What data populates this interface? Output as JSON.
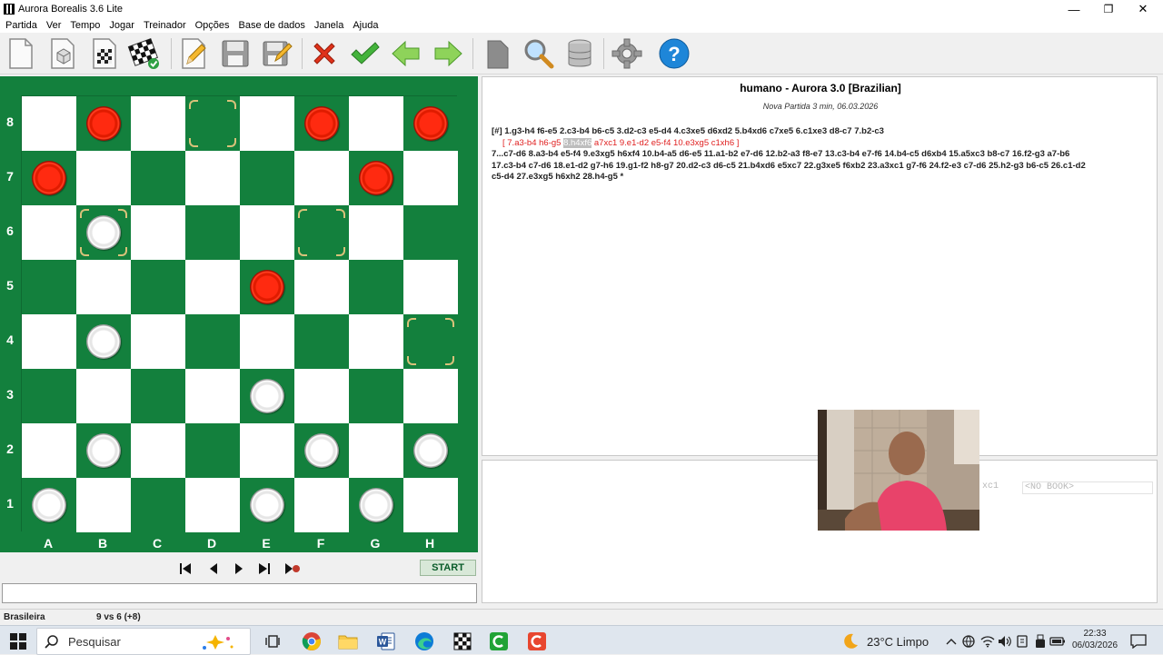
{
  "window": {
    "title": "Aurora Borealis 3.6 Lite",
    "minimize": "—",
    "restore": "❐",
    "close": "✕"
  },
  "menu": [
    "Partida",
    "Ver",
    "Tempo",
    "Jogar",
    "Treinador",
    "Opções",
    "Base de dados",
    "Janela",
    "Ajuda"
  ],
  "toolbar": {
    "icons": [
      "new-document-icon",
      "dice-icon",
      "board-icon",
      "checkered-flag-icon",
      "pencil-icon",
      "save-icon",
      "save-edit-icon",
      "cancel-icon",
      "checkmark-icon",
      "arrow-left-icon",
      "arrow-right-icon",
      "tag-icon",
      "magnifier-icon",
      "database-icon",
      "gear-icon",
      "help-icon"
    ]
  },
  "board": {
    "ranks": [
      "8",
      "7",
      "6",
      "5",
      "4",
      "3",
      "2",
      "1"
    ],
    "files": [
      "A",
      "B",
      "C",
      "D",
      "E",
      "F",
      "G",
      "H"
    ],
    "pieces": {
      "b8": "red",
      "f8": "red",
      "h8": "red",
      "a7": "red",
      "g7": "red",
      "b6": "white",
      "e5": "red",
      "b4": "white",
      "e3": "white",
      "b2": "white",
      "f2": "white",
      "h2": "white",
      "a1": "white",
      "e1": "white",
      "g1": "white"
    },
    "highlights": [
      "d8",
      "b6",
      "f6",
      "h4"
    ],
    "colors": {
      "dark": "#13803d",
      "light": "#ffffff",
      "red": "#ff2a10",
      "highlight": "#d9c27a"
    }
  },
  "controls": {
    "start_label": "START"
  },
  "status": {
    "variant": "Brasileira",
    "score": "9 vs 6  (+8)"
  },
  "game": {
    "title": "humano - Aurora 3.0 [Brazilian]",
    "subtitle": "Nova Partida 3 min, 06.03.2026",
    "line1": "[#] 1.g3-h4 f6-e5 2.c3-b4 b6-c5 3.d2-c3 e5-d4 4.c3xe5 d6xd2 5.b4xd6 c7xe5 6.c1xe3 d8-c7 7.b2-c3",
    "variation_pre": "[ 7.a3-b4 h6-g5 ",
    "variation_hl": "8.h4xf6",
    "variation_post": " a7xc1 9.e1-d2 e5-f4 10.e3xg5 c1xh6 ]",
    "line3": "7...c7-d6 8.a3-b4 e5-f4 9.e3xg5 h6xf4 10.b4-a5 d6-e5 11.a1-b2 e7-d6 12.b2-a3 f8-e7 13.c3-b4 e7-f6 14.b4-c5 d6xb4 15.a5xc3 b8-c7 16.f2-g3 a7-b6",
    "line4": "17.c3-b4 c7-d6 18.e1-d2 g7-h6 19.g1-f2 h8-g7 20.d2-c3 d6-c5 21.b4xd6 e5xc7 22.g3xe5 f6xb2 23.a3xc1 g7-f6 24.f2-e3 c7-d6 25.h2-g3 b6-c5 26.c1-d2",
    "line5": "c5-d4 27.e3xg5 h6xh2 28.h4-g5 *"
  },
  "book": {
    "move": "xc1",
    "entry": "<NO BOOK>"
  },
  "taskbar": {
    "search_placeholder": "Pesquisar",
    "weather": "23°C  Limpo",
    "time": "22:33",
    "date": "06/03/2026"
  }
}
